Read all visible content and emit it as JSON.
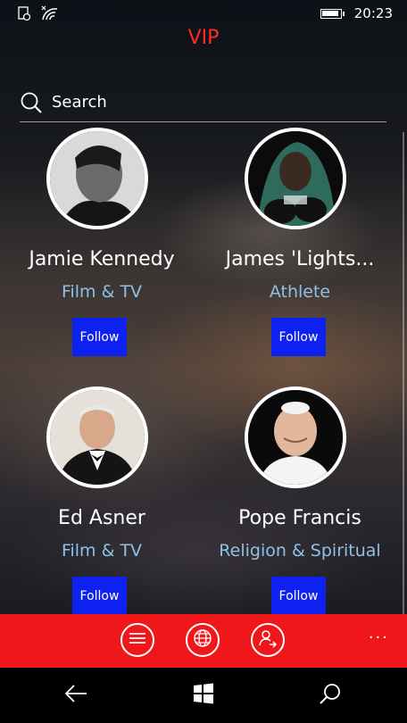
{
  "status": {
    "time": "20:23",
    "battery_level": 0.85,
    "icons": [
      "notification-icon",
      "wifi-icon",
      "battery-icon"
    ]
  },
  "header": {
    "title": "VIP"
  },
  "search": {
    "label": "Search"
  },
  "profiles": [
    {
      "name": "Jamie Kennedy",
      "category": "Film & TV",
      "follow_label": "Follow"
    },
    {
      "name": "James 'Lights...",
      "category": "Athlete",
      "follow_label": "Follow"
    },
    {
      "name": "Ed Asner",
      "category": "Film & TV",
      "follow_label": "Follow"
    },
    {
      "name": "Pope Francis",
      "category": "Religion & Spiritual",
      "follow_label": "Follow"
    }
  ],
  "appbar": {
    "buttons": [
      "menu-icon",
      "globe-icon",
      "user-share-icon"
    ],
    "more_label": "···"
  },
  "navbar": {
    "buttons": [
      "back-icon",
      "windows-icon",
      "search-icon"
    ]
  },
  "colors": {
    "title": "#ff2a2a",
    "category": "#8ec0e8",
    "follow": "#0d22f0",
    "appbar": "#f0171b"
  }
}
